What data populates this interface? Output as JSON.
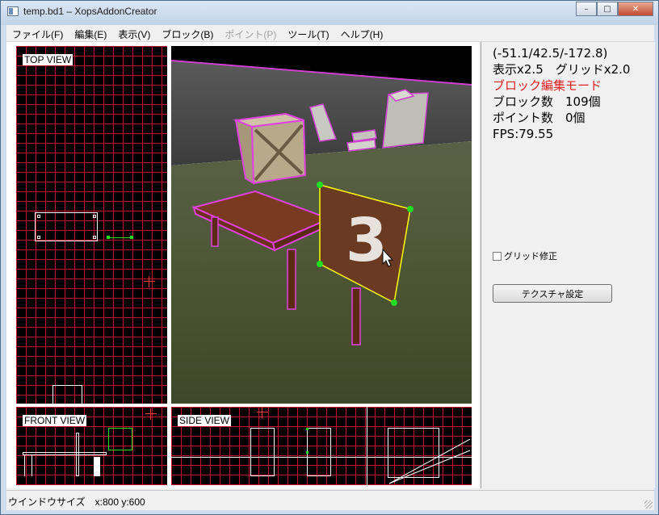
{
  "window": {
    "title": "temp.bd1 – XopsAddonCreator",
    "minimize_glyph": "–",
    "maximize_glyph": "□",
    "close_glyph": "✕"
  },
  "menubar": {
    "items": [
      {
        "label": "ファイル(F)",
        "enabled": true
      },
      {
        "label": "編集(E)",
        "enabled": true
      },
      {
        "label": "表示(V)",
        "enabled": true
      },
      {
        "label": "ブロック(B)",
        "enabled": true
      },
      {
        "label": "ポイント(P)",
        "enabled": false
      },
      {
        "label": "ツール(T)",
        "enabled": true
      },
      {
        "label": "ヘルプ(H)",
        "enabled": true
      }
    ]
  },
  "views": {
    "top": "TOP VIEW",
    "front": "FRONT VIEW",
    "side": "SIDE VIEW"
  },
  "info": {
    "coords": "(-51.1/42.5/-172.8)",
    "zoom_grid": "表示x2.5　グリッドx2.0",
    "mode": "ブロック編集モード",
    "block_count": "ブロック数　109個",
    "point_count": "ポイント数　0個",
    "fps": "FPS:79.55"
  },
  "controls": {
    "grid_fix_label": "グリッド修正",
    "grid_fix_checked": false,
    "texture_button": "テクスチャ設定"
  },
  "status": {
    "window_size": "ウインドウサイズ　x:800 y:600"
  },
  "colors": {
    "grid_line": "#c8102e",
    "mode_text": "#e02020",
    "selection_edge": "#ffff00",
    "selection_vertex": "#22dd22",
    "block_outline": "#e040e0"
  }
}
